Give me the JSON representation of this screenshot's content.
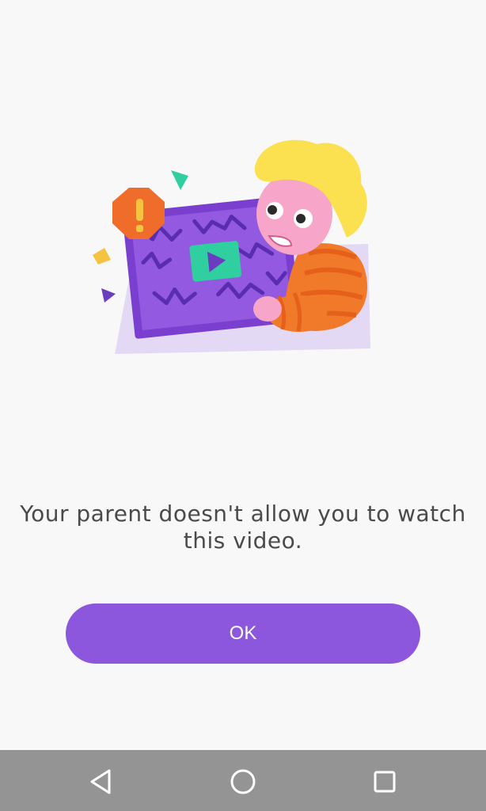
{
  "dialog": {
    "message": "Your parent doesn't allow you to watch this video.",
    "ok_label": "OK"
  },
  "illustration": {
    "subject": "child with blocked video tablet",
    "icons": [
      "warning-icon",
      "play-icon"
    ]
  },
  "nav_bar": {
    "buttons": [
      "back-icon",
      "home-icon",
      "recents-icon"
    ]
  },
  "colors": {
    "background": "#f8f8f8",
    "accent": "#8c57dc",
    "text": "#4a4a4a",
    "nav_bar": "#949494"
  }
}
